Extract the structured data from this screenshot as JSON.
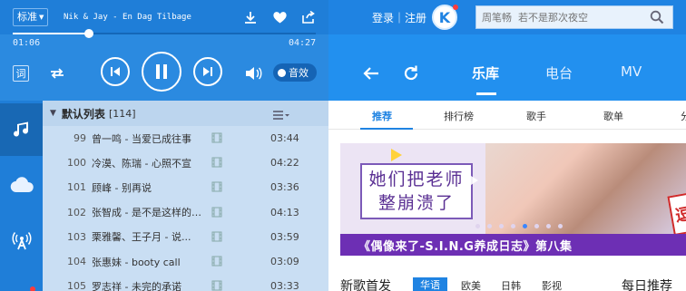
{
  "colors": {
    "brand_blue": "#1f83e2",
    "panel_blue": "#2b8ae0",
    "playlist_bg": "#c9def3",
    "banner_purple": "#6d2fb4",
    "badge_red": "#ff3b3b"
  },
  "player": {
    "quality_label": "标准",
    "song_title": "Nik & Jay - En Dag Tilbage",
    "time_current": "01:06",
    "time_total": "04:27",
    "progress_fraction": 0.25,
    "lyric_label": "词",
    "sound_effect_label": "音效"
  },
  "header": {
    "login_text": "登录｜注册",
    "logo_letter": "K",
    "search_placeholder": "周笔畅  若不是那次夜空",
    "main_tabs": [
      "乐库",
      "电台",
      "MV"
    ],
    "active_main_tab": "乐库"
  },
  "playlist": {
    "name": "默认列表",
    "count": "[114]",
    "songs": [
      {
        "num": "99",
        "title": "曾一鸣 - 当爱已成往事",
        "duration": "03:44"
      },
      {
        "num": "100",
        "title": "冷漠、陈瑞 - 心照不宣",
        "duration": "04:22"
      },
      {
        "num": "101",
        "title": "顾峰 - 别再说",
        "duration": "03:36"
      },
      {
        "num": "102",
        "title": "张智成 - 是不是这样的夜...",
        "duration": "04:13"
      },
      {
        "num": "103",
        "title": "栗雅馨、王子月 - 说...",
        "duration": "03:59"
      },
      {
        "num": "104",
        "title": "张惠妹 - booty call",
        "duration": "03:09"
      },
      {
        "num": "105",
        "title": "罗志祥 - 未完的承诺",
        "duration": "03:33"
      }
    ]
  },
  "content": {
    "subtabs": [
      "推荐",
      "排行榜",
      "歌手",
      "歌单",
      "分"
    ],
    "active_subtab": "推荐",
    "banner": {
      "card_line1": "她们把老师",
      "card_line2": "整崩溃了",
      "caption": "《偶像来了-S.I.N.G养成日志》第八集",
      "sticker": "逗",
      "dot_count": 8,
      "active_dot": 4
    },
    "new_songs": {
      "title": "新歌首发",
      "tabs": [
        "华语",
        "欧美",
        "日韩",
        "影视"
      ],
      "active_tab": "华语",
      "daily_title": "每日推荐"
    }
  }
}
